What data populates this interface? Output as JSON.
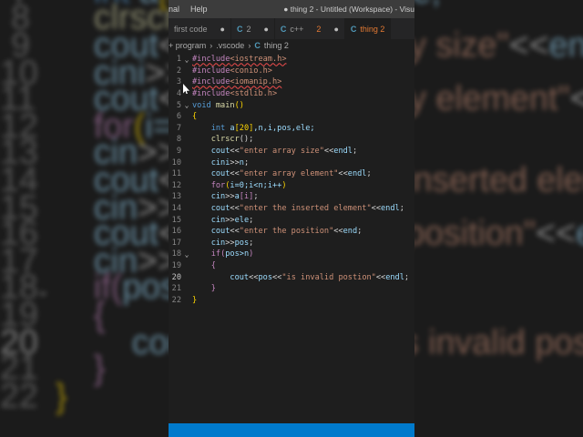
{
  "titlebar": {
    "menus": [
      "nal",
      "Help"
    ],
    "title": "● thing 2 - Untitled (Workspace) - Visu"
  },
  "tabs": [
    {
      "label": "first code",
      "badge": "",
      "dirty": "●",
      "active": false,
      "icon": false
    },
    {
      "label": "2",
      "badge": "",
      "dirty": "●",
      "active": false,
      "icon": true
    },
    {
      "label": "c++",
      "badge": "2",
      "dirty": "●",
      "active": false,
      "icon": true
    },
    {
      "label": "thing 2",
      "badge": "",
      "dirty": "",
      "active": true,
      "icon": true
    }
  ],
  "breadcrumb": [
    "+ program",
    ".vscode",
    "thing 2"
  ],
  "code": [
    {
      "n": "1",
      "fold": "⌄",
      "seg": [
        [
          "#include",
          "inc squig"
        ],
        [
          "<iostream.h>",
          "hdr squig"
        ]
      ]
    },
    {
      "n": "2",
      "fold": "",
      "seg": [
        [
          "#include",
          "inc"
        ],
        [
          "<conio.h>",
          "hdr"
        ]
      ]
    },
    {
      "n": "3",
      "fold": "",
      "seg": [
        [
          "#include",
          "inc squig"
        ],
        [
          "<iomanip.h>",
          "hdr squig"
        ]
      ]
    },
    {
      "n": "4",
      "fold": "",
      "seg": [
        [
          "#include",
          "inc"
        ],
        [
          "<stdlib.h>",
          "hdr"
        ]
      ]
    },
    {
      "n": "5",
      "fold": "⌄",
      "seg": [
        [
          "void ",
          "kw"
        ],
        [
          "main",
          "fn"
        ],
        [
          "()",
          "br"
        ]
      ]
    },
    {
      "n": "6",
      "fold": "",
      "seg": [
        [
          "{",
          "br"
        ]
      ]
    },
    {
      "n": "7",
      "fold": "",
      "seg": [
        [
          "    "
        ],
        [
          "int ",
          "kw"
        ],
        [
          "a",
          "var"
        ],
        [
          "[20]",
          "br"
        ],
        [
          ",n,i,pos,ele;",
          "var"
        ]
      ]
    },
    {
      "n": "8",
      "fold": "",
      "seg": [
        [
          "    "
        ],
        [
          "clrscr",
          "fn"
        ],
        [
          "();"
        ]
      ]
    },
    {
      "n": "9",
      "fold": "",
      "seg": [
        [
          "    "
        ],
        [
          "cout",
          "var"
        ],
        [
          "<<"
        ],
        [
          "\"enter array size\"",
          "str"
        ],
        [
          "<<"
        ],
        [
          "endl",
          "var"
        ],
        [
          ";"
        ]
      ]
    },
    {
      "n": "10",
      "fold": "",
      "seg": [
        [
          "    "
        ],
        [
          "cini",
          "var"
        ],
        [
          ">>"
        ],
        [
          "n",
          "var"
        ],
        [
          ";"
        ]
      ]
    },
    {
      "n": "11",
      "fold": "",
      "seg": [
        [
          "    "
        ],
        [
          "cout",
          "var"
        ],
        [
          "<<"
        ],
        [
          "\"enter array element\"",
          "str"
        ],
        [
          "<<"
        ],
        [
          "endl",
          "var"
        ],
        [
          ";"
        ]
      ]
    },
    {
      "n": "12",
      "fold": "",
      "seg": [
        [
          "    "
        ],
        [
          "for",
          "ctl"
        ],
        [
          "(",
          "br"
        ],
        [
          "i=0;i<n;i++",
          "var"
        ],
        [
          ")",
          "br"
        ]
      ]
    },
    {
      "n": "13",
      "fold": "",
      "seg": [
        [
          "    "
        ],
        [
          "cin",
          "var"
        ],
        [
          ">>"
        ],
        [
          "a",
          "var"
        ],
        [
          "[i]",
          "ctl"
        ],
        [
          ";"
        ]
      ]
    },
    {
      "n": "14",
      "fold": "",
      "seg": [
        [
          "    "
        ],
        [
          "cout",
          "var"
        ],
        [
          "<<"
        ],
        [
          "\"enter the inserted element\"",
          "str"
        ],
        [
          "<<"
        ],
        [
          "endl",
          "var"
        ],
        [
          ";"
        ]
      ]
    },
    {
      "n": "15",
      "fold": "",
      "seg": [
        [
          "    "
        ],
        [
          "cin",
          "var"
        ],
        [
          ">>"
        ],
        [
          "ele",
          "var"
        ],
        [
          ";"
        ]
      ]
    },
    {
      "n": "16",
      "fold": "",
      "seg": [
        [
          "    "
        ],
        [
          "cout",
          "var"
        ],
        [
          "<<"
        ],
        [
          "\"enter the position\"",
          "str"
        ],
        [
          "<<"
        ],
        [
          "end",
          "var"
        ],
        [
          ";"
        ]
      ]
    },
    {
      "n": "17",
      "fold": "",
      "seg": [
        [
          "    "
        ],
        [
          "cin",
          "var"
        ],
        [
          ">>"
        ],
        [
          "pos",
          "var"
        ],
        [
          ";"
        ]
      ]
    },
    {
      "n": "18",
      "fold": "⌄",
      "seg": [
        [
          "    "
        ],
        [
          "if",
          "ctl"
        ],
        [
          "(",
          "ctl"
        ],
        [
          "pos>n",
          "var"
        ],
        [
          ")",
          "ctl"
        ]
      ]
    },
    {
      "n": "19",
      "fold": "",
      "seg": [
        [
          "    "
        ],
        [
          "{",
          "ctl"
        ]
      ]
    },
    {
      "n": "20",
      "fold": "",
      "cur": true,
      "seg": [
        [
          "        "
        ],
        [
          "cout",
          "var"
        ],
        [
          "<<"
        ],
        [
          "pos",
          "var"
        ],
        [
          "<<"
        ],
        [
          "\"is invalid postion\"",
          "str"
        ],
        [
          "<<"
        ],
        [
          "endl",
          "var"
        ],
        [
          ";"
        ]
      ]
    },
    {
      "n": "21",
      "fold": "",
      "seg": [
        [
          "    "
        ],
        [
          "}",
          "ctl"
        ]
      ]
    },
    {
      "n": "22",
      "fold": "",
      "seg": [
        [
          "}",
          "br"
        ]
      ]
    }
  ]
}
